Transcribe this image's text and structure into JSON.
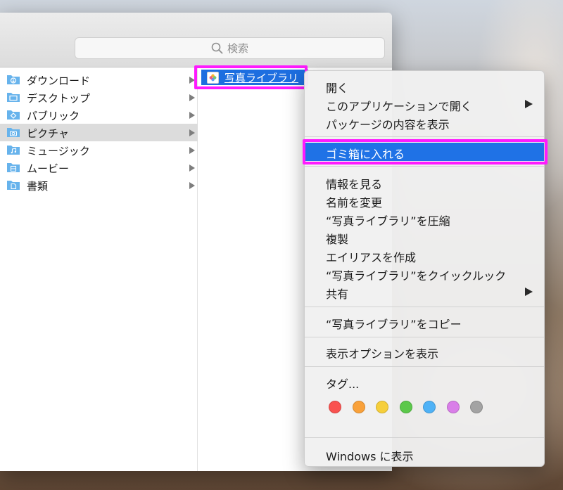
{
  "search": {
    "placeholder": "検索"
  },
  "sidebar": {
    "items": [
      {
        "label": "ダウンロード",
        "icon": "download-folder-icon"
      },
      {
        "label": "デスクトップ",
        "icon": "desktop-folder-icon"
      },
      {
        "label": "パブリック",
        "icon": "public-folder-icon"
      },
      {
        "label": "ピクチャ",
        "icon": "pictures-folder-icon",
        "selected": true
      },
      {
        "label": "ミュージック",
        "icon": "music-folder-icon"
      },
      {
        "label": "ムービー",
        "icon": "movies-folder-icon"
      },
      {
        "label": "書類",
        "icon": "documents-folder-icon"
      }
    ]
  },
  "column2": {
    "selected_item": "写真ライブラリ"
  },
  "menu": {
    "open": "開く",
    "open_with": "このアプリケーションで開く",
    "show_package": "パッケージの内容を表示",
    "move_to_trash": "ゴミ箱に入れる",
    "get_info": "情報を見る",
    "rename": "名前を変更",
    "compress": "“写真ライブラリ”を圧縮",
    "duplicate": "複製",
    "make_alias": "エイリアスを作成",
    "quick_look": "“写真ライブラリ”をクイックルック",
    "share": "共有",
    "copy": "“写真ライブラリ”をコピー",
    "view_options": "表示オプションを表示",
    "tags": "タグ...",
    "show_in_windows": "Windows に表示"
  },
  "tag_colors": [
    "#f9524f",
    "#f9a13a",
    "#f6cf3b",
    "#5bc84a",
    "#4fb2f6",
    "#d97ee8",
    "#a3a3a3"
  ]
}
